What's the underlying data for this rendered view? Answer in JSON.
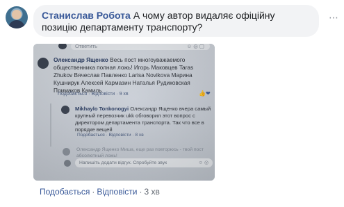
{
  "comment": {
    "author": "Станислав Робота",
    "text": "А чому автор видаляє офіційну позицію департаменту транспорту?",
    "actions": {
      "like": "Подобається",
      "reply": "Відповісти",
      "time": "3 хв"
    }
  },
  "photo": {
    "top_field": "Ответить",
    "main": {
      "author": "Олександр Ященко",
      "text": "Весь пост многоуважаемого общественника полная ложь! Игорь Маковцев Taras Zhukov Вячеслав Павленко Larisa Novikova Марина Кушнирук Алексей Кармазин Наталья Рудиковская Примаков Камиль",
      "like": "Подобається",
      "reply": "Відповісти",
      "time": "9 хв"
    },
    "reply1": {
      "author": "Mikhaylo Tonkonogyi",
      "text": "Олександр Ященко вчера самый крупный перевозчик ukk обговорил этот вопрос с директором департамента транспорта. Так что все в порядке вещей",
      "like": "Подобається",
      "reply": "Відповісти",
      "time": "8 хв"
    },
    "reply2": {
      "text": "Олександр Ященко Миша, еще раз повторюсь - твой пост абсолютный ложь!"
    },
    "input": {
      "placeholder": "Напишіть додати відгук. Спробуйте звук"
    }
  }
}
